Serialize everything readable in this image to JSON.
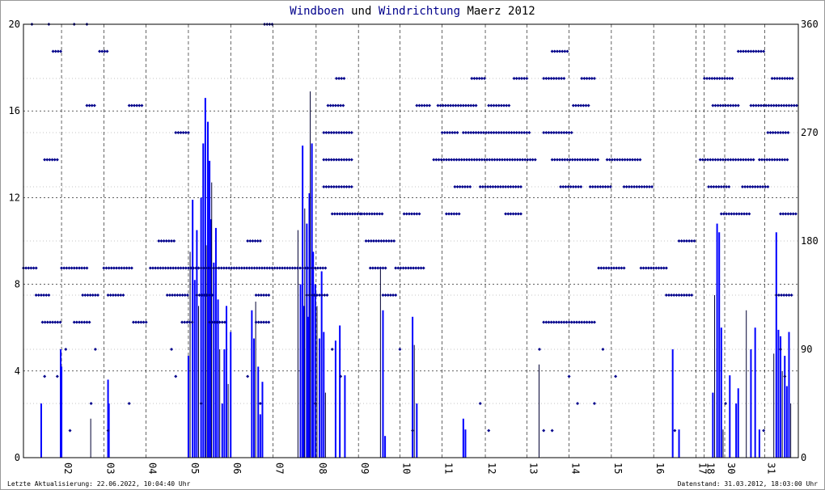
{
  "chart_data": {
    "type": "bar",
    "title_parts": [
      {
        "text": "Windboen",
        "color": "#00008b"
      },
      {
        "text": " und ",
        "color": "#000000"
      },
      {
        "text": "Windrichtung",
        "color": "#00008b"
      },
      {
        "text": " Maerz 2012",
        "color": "#000000"
      }
    ],
    "xlim": [
      0,
      18.32
    ],
    "x_ticks": [
      {
        "label": "02",
        "x": 0.9
      },
      {
        "label": "03",
        "x": 1.9
      },
      {
        "label": "04",
        "x": 2.9
      },
      {
        "label": "05",
        "x": 3.9
      },
      {
        "label": "06",
        "x": 4.9
      },
      {
        "label": "07",
        "x": 5.9
      },
      {
        "label": "08",
        "x": 6.92
      },
      {
        "label": "09",
        "x": 7.92
      },
      {
        "label": "10",
        "x": 8.9
      },
      {
        "label": "11",
        "x": 9.9
      },
      {
        "label": "12",
        "x": 10.92
      },
      {
        "label": "13",
        "x": 11.9
      },
      {
        "label": "14",
        "x": 12.9
      },
      {
        "label": "15",
        "x": 13.9
      },
      {
        "label": "16",
        "x": 14.9
      },
      {
        "label": "17",
        "x": 15.9
      },
      {
        "label": "18",
        "x": 16.09
      },
      {
        "label": "30",
        "x": 16.58
      },
      {
        "label": "31",
        "x": 17.53
      }
    ],
    "y_left": {
      "label": "Windboen",
      "range": [
        0,
        20
      ],
      "ticks": [
        0,
        4,
        8,
        12,
        16,
        20
      ]
    },
    "y_right": {
      "label": "Windrichtung",
      "range": [
        0,
        360
      ],
      "ticks": [
        0,
        90,
        180,
        270,
        360
      ]
    },
    "gusts": [
      [
        0.42,
        2.5
      ],
      [
        0.88,
        5.0
      ],
      [
        0.9,
        4.2
      ],
      [
        1.6,
        1.8
      ],
      [
        2.0,
        3.6
      ],
      [
        2.02,
        2.5
      ],
      [
        3.9,
        4.7
      ],
      [
        3.95,
        9.5
      ],
      [
        4.0,
        11.9
      ],
      [
        4.05,
        8.2
      ],
      [
        4.1,
        10.5
      ],
      [
        4.15,
        7.0
      ],
      [
        4.2,
        12.0
      ],
      [
        4.25,
        14.5
      ],
      [
        4.3,
        16.6
      ],
      [
        4.33,
        9.8
      ],
      [
        4.36,
        15.5
      ],
      [
        4.4,
        13.7
      ],
      [
        4.43,
        11.0
      ],
      [
        4.46,
        12.7
      ],
      [
        4.5,
        9.0
      ],
      [
        4.55,
        10.6
      ],
      [
        4.6,
        7.3
      ],
      [
        4.65,
        5.0
      ],
      [
        4.7,
        2.5
      ],
      [
        4.75,
        5.0
      ],
      [
        4.8,
        7.0
      ],
      [
        4.85,
        3.4
      ],
      [
        4.9,
        5.8
      ],
      [
        5.4,
        6.8
      ],
      [
        5.45,
        5.5
      ],
      [
        5.5,
        7.2
      ],
      [
        5.55,
        4.2
      ],
      [
        5.6,
        2.0
      ],
      [
        5.65,
        3.5
      ],
      [
        6.5,
        10.5
      ],
      [
        6.55,
        8.0
      ],
      [
        6.6,
        14.4
      ],
      [
        6.63,
        7.0
      ],
      [
        6.66,
        11.5
      ],
      [
        6.7,
        10.8
      ],
      [
        6.73,
        6.5
      ],
      [
        6.76,
        12.2
      ],
      [
        6.79,
        16.9
      ],
      [
        6.82,
        14.5
      ],
      [
        6.85,
        9.5
      ],
      [
        6.9,
        8.0
      ],
      [
        6.95,
        7.0
      ],
      [
        7.0,
        5.5
      ],
      [
        7.05,
        8.6
      ],
      [
        7.1,
        5.8
      ],
      [
        7.15,
        3.0
      ],
      [
        7.38,
        5.4
      ],
      [
        7.48,
        6.1
      ],
      [
        7.6,
        3.8
      ],
      [
        8.45,
        8.8
      ],
      [
        8.5,
        6.8
      ],
      [
        8.55,
        1.0
      ],
      [
        9.2,
        6.5
      ],
      [
        9.25,
        5.2
      ],
      [
        9.3,
        2.5
      ],
      [
        10.4,
        1.8
      ],
      [
        10.45,
        1.3
      ],
      [
        12.2,
        4.3
      ],
      [
        15.35,
        5.0
      ],
      [
        15.5,
        1.3
      ],
      [
        16.3,
        3.0
      ],
      [
        16.35,
        7.5
      ],
      [
        16.4,
        10.8
      ],
      [
        16.45,
        10.4
      ],
      [
        16.5,
        6.0
      ],
      [
        16.55,
        1.3
      ],
      [
        16.7,
        3.8
      ],
      [
        16.85,
        2.5
      ],
      [
        16.9,
        3.2
      ],
      [
        17.1,
        6.8
      ],
      [
        17.2,
        5.0
      ],
      [
        17.3,
        6.0
      ],
      [
        17.4,
        1.3
      ],
      [
        17.75,
        4.8
      ],
      [
        17.8,
        10.4
      ],
      [
        17.85,
        5.9
      ],
      [
        17.9,
        5.6
      ],
      [
        17.95,
        4.0
      ],
      [
        18.0,
        4.7
      ],
      [
        18.05,
        3.3
      ],
      [
        18.1,
        5.8
      ],
      [
        18.15,
        2.5
      ]
    ],
    "direction_runs": [
      [
        0.0,
        0.3,
        157.5
      ],
      [
        0.3,
        0.6,
        135
      ],
      [
        0.45,
        0.9,
        112.5
      ],
      [
        0.5,
        0.8,
        247.5
      ],
      [
        0.7,
        0.9,
        337.5
      ],
      [
        0.9,
        1.5,
        157.5
      ],
      [
        1.2,
        1.6,
        112.5
      ],
      [
        1.4,
        1.8,
        135
      ],
      [
        1.5,
        1.7,
        292.5
      ],
      [
        1.8,
        2.0,
        337.5
      ],
      [
        1.9,
        2.6,
        157.5
      ],
      [
        2.0,
        2.4,
        135
      ],
      [
        2.6,
        2.9,
        112.5
      ],
      [
        2.5,
        2.8,
        292.5
      ],
      [
        3.0,
        7.19,
        157.5
      ],
      [
        3.2,
        3.6,
        180
      ],
      [
        3.4,
        3.9,
        135
      ],
      [
        3.6,
        3.9,
        270
      ],
      [
        3.75,
        4.0,
        112.5
      ],
      [
        4.1,
        4.5,
        135
      ],
      [
        4.4,
        4.8,
        112.5
      ],
      [
        5.3,
        5.6,
        180
      ],
      [
        5.5,
        5.8,
        112.5
      ],
      [
        5.5,
        5.8,
        135
      ],
      [
        5.7,
        5.9,
        360
      ],
      [
        6.7,
        7.2,
        135
      ],
      [
        7.1,
        7.8,
        270
      ],
      [
        7.1,
        7.8,
        247.5
      ],
      [
        7.1,
        7.8,
        225
      ],
      [
        7.2,
        7.6,
        292.5
      ],
      [
        7.3,
        7.6,
        202.5
      ],
      [
        7.4,
        7.6,
        315
      ],
      [
        7.6,
        8.0,
        202.5
      ],
      [
        8.0,
        8.5,
        202.5
      ],
      [
        8.1,
        8.8,
        180
      ],
      [
        8.2,
        8.6,
        157.5
      ],
      [
        8.5,
        8.8,
        135
      ],
      [
        8.8,
        9.5,
        157.5
      ],
      [
        9.0,
        9.4,
        202.5
      ],
      [
        9.3,
        9.6,
        292.5
      ],
      [
        9.7,
        12.1,
        247.5
      ],
      [
        9.8,
        10.7,
        292.5
      ],
      [
        9.9,
        10.3,
        270
      ],
      [
        10.0,
        10.3,
        202.5
      ],
      [
        10.2,
        10.6,
        225
      ],
      [
        10.4,
        12.0,
        270
      ],
      [
        10.6,
        10.9,
        315
      ],
      [
        10.8,
        11.8,
        225
      ],
      [
        11.0,
        11.5,
        292.5
      ],
      [
        11.6,
        11.9,
        315
      ],
      [
        11.4,
        11.8,
        202.5
      ],
      [
        12.3,
        13.5,
        112.5
      ],
      [
        12.3,
        13.0,
        270
      ],
      [
        12.3,
        12.8,
        315
      ],
      [
        12.5,
        12.9,
        337.5
      ],
      [
        12.5,
        13.6,
        247.5
      ],
      [
        12.7,
        13.2,
        225
      ],
      [
        13.0,
        13.4,
        292.5
      ],
      [
        13.2,
        13.5,
        315
      ],
      [
        13.4,
        13.9,
        225
      ],
      [
        13.6,
        14.2,
        157.5
      ],
      [
        13.8,
        14.6,
        247.5
      ],
      [
        14.2,
        14.9,
        225
      ],
      [
        14.6,
        15.2,
        157.5
      ],
      [
        15.2,
        15.8,
        135
      ],
      [
        15.5,
        15.9,
        180
      ],
      [
        16.0,
        17.3,
        247.5
      ],
      [
        16.1,
        16.8,
        315
      ],
      [
        16.2,
        16.7,
        225
      ],
      [
        16.3,
        16.9,
        292.5
      ],
      [
        16.5,
        17.2,
        202.5
      ],
      [
        16.9,
        17.5,
        337.5
      ],
      [
        17.2,
        17.8,
        292.5
      ],
      [
        17.0,
        17.6,
        225
      ],
      [
        17.4,
        18.1,
        247.5
      ],
      [
        17.6,
        18.1,
        270
      ],
      [
        17.7,
        18.2,
        315
      ],
      [
        17.8,
        18.2,
        135
      ],
      [
        17.8,
        18.3,
        292.5
      ],
      [
        17.9,
        18.3,
        202.5
      ]
    ],
    "direction_points": [
      [
        0.2,
        360
      ],
      [
        0.6,
        360
      ],
      [
        1.2,
        360
      ],
      [
        1.5,
        360
      ],
      [
        1.1,
        22.5
      ],
      [
        1.6,
        45
      ],
      [
        2.5,
        45
      ],
      [
        0.5,
        67.5
      ],
      [
        0.8,
        67.5
      ],
      [
        1.0,
        90
      ],
      [
        1.7,
        90
      ],
      [
        2.0,
        22.5
      ],
      [
        3.5,
        90
      ],
      [
        3.6,
        67.5
      ],
      [
        4.2,
        45
      ],
      [
        5.3,
        67.5
      ],
      [
        5.6,
        45
      ],
      [
        6.9,
        45
      ],
      [
        7.3,
        90
      ],
      [
        7.5,
        67.5
      ],
      [
        8.9,
        90
      ],
      [
        9.2,
        22.5
      ],
      [
        10.8,
        45
      ],
      [
        11.0,
        22.5
      ],
      [
        12.2,
        90
      ],
      [
        12.3,
        22.5
      ],
      [
        12.5,
        22.5
      ],
      [
        12.9,
        67.5
      ],
      [
        13.1,
        45
      ],
      [
        13.5,
        45
      ],
      [
        13.7,
        90
      ],
      [
        14.0,
        67.5
      ],
      [
        15.4,
        22.5
      ],
      [
        16.6,
        45
      ],
      [
        17.5,
        22.5
      ],
      [
        17.9,
        90
      ],
      [
        18.0,
        67.5
      ]
    ],
    "series_colors": {
      "gusts": "#0000ff",
      "direction": "#00008b"
    },
    "grid": true
  },
  "footer": {
    "left": "Letzte Aktualisierung: 22.06.2022, 10:04:40 Uhr",
    "right": "Datenstand: 31.03.2012, 18:03:00 Uhr"
  }
}
